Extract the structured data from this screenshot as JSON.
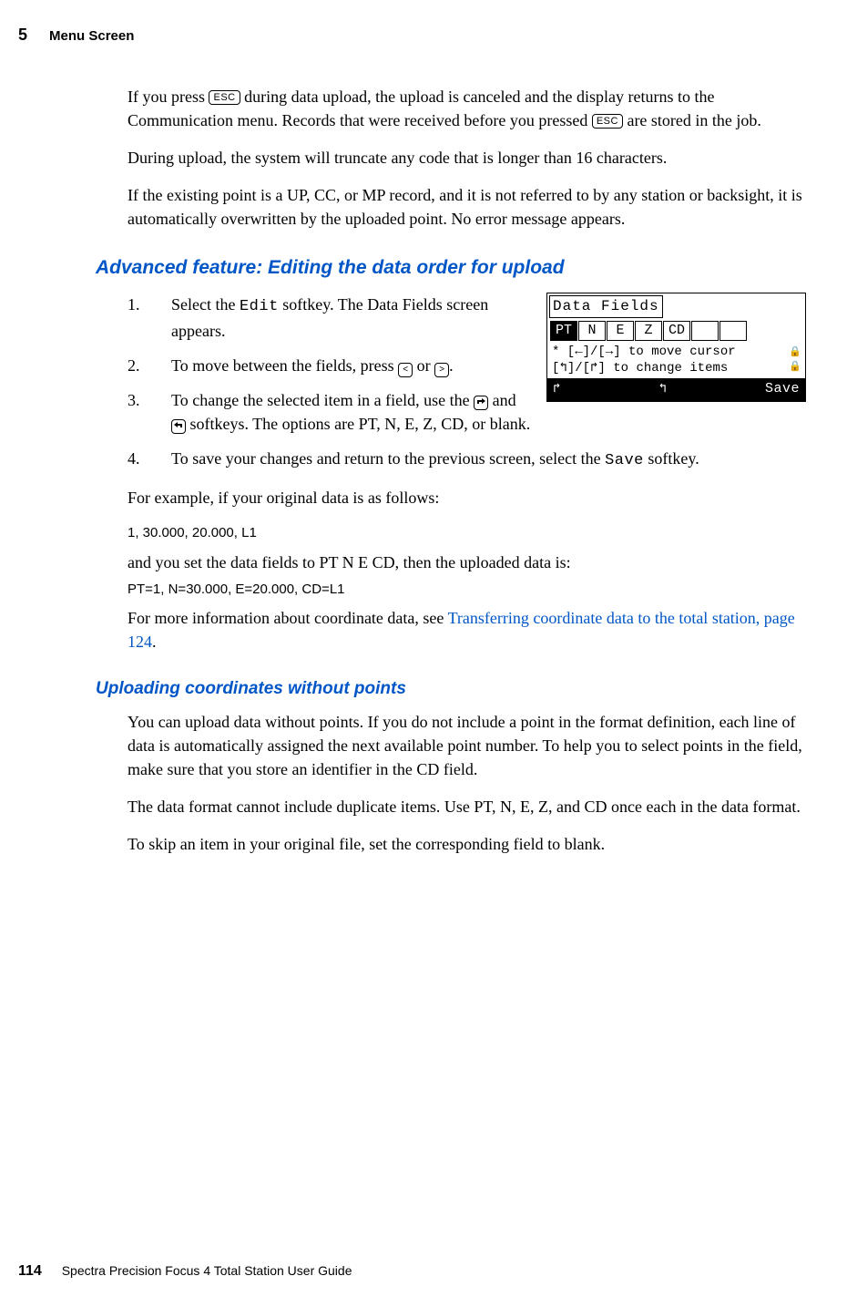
{
  "header": {
    "chapter_num": "5",
    "chapter_title": "Menu Screen"
  },
  "p1_a": "If you press ",
  "p1_esc1": "ESC",
  "p1_b": " during data upload, the upload is canceled and the display returns to the Communication menu. Records that were received before you pressed ",
  "p1_esc2": "ESC",
  "p1_c": " are stored in the job.",
  "p2": "During upload, the system will truncate any code that is longer than 16 characters.",
  "p3": "If the existing point is a UP, CC, or MP record, and it is not referred to by any station or backsight, it is automatically overwritten by the uploaded point. No error message appears.",
  "sec1_heading": "Advanced feature: Editing the data order for upload",
  "li1_a": "Select the ",
  "li1_edit": "Edit",
  "li1_b": " softkey. The Data Fields screen appears.",
  "li2_a": "To move between the fields, press ",
  "li2_left": "<",
  "li2_mid": " or ",
  "li2_right": ">",
  "li2_b": ".",
  "li3_a": "To change the selected item in a field, use the ",
  "li3_b": " and ",
  "li3_c": " softkeys. The options are PT, N, E, Z, CD, or blank.",
  "li4_a": "To save your changes and return to the previous screen, select the ",
  "li4_save": "Save",
  "li4_b": " softkey.",
  "p4": "For example, if your original data is as follows:",
  "code1": "1, 30.000, 20.000, L1",
  "p5": "and you set the data fields to PT N E CD, then the uploaded data is:",
  "code2": "PT=1, N=30.000, E=20.000, CD=L1",
  "p6_a": "For more information about coordinate data, see ",
  "p6_link": "Transferring coordinate data to the total station, page 124",
  "p6_b": ".",
  "sec2_heading": "Uploading coordinates without points",
  "p7": "You can upload data without points. If you do not include a point in the format definition, each line of data is automatically assigned the next available point number. To help you to select points in the field, make sure that you store an identifier in the CD field.",
  "p8": "The data format cannot include duplicate items. Use PT, N, E, Z, and CD once each in the data format.",
  "p9": "To skip an item in your original file, set the corresponding field to blank.",
  "screen": {
    "title": "Data Fields",
    "f1": "PT",
    "f2": "N",
    "f3": "E",
    "f4": "Z",
    "f5": "CD",
    "f6": "",
    "f7": "",
    "line1": "* [←]/[→] to move cursor",
    "line2": "  [↰]/[↱] to change items",
    "save": "Save"
  },
  "footer": {
    "page": "114",
    "book": "Spectra Precision Focus 4 Total Station User Guide"
  }
}
